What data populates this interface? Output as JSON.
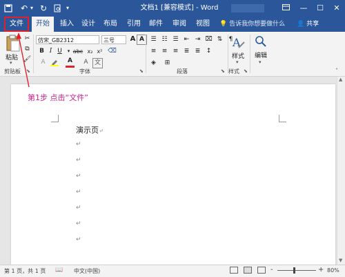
{
  "titlebar": {
    "title": "文档1 [兼容模式] - Word",
    "save_icon": "save-icon",
    "undo_icon": "undo-icon",
    "redo_icon": "redo-icon",
    "preview_icon": "print-preview-icon",
    "window_controls": [
      "ribbon-options-icon",
      "minimize-icon",
      "maximize-icon",
      "close-icon"
    ]
  },
  "tabs": [
    {
      "label": "文件",
      "id": "file"
    },
    {
      "label": "开始",
      "id": "home"
    },
    {
      "label": "插入",
      "id": "insert"
    },
    {
      "label": "设计",
      "id": "design"
    },
    {
      "label": "布局",
      "id": "layout"
    },
    {
      "label": "引用",
      "id": "references"
    },
    {
      "label": "邮件",
      "id": "mailings"
    },
    {
      "label": "审阅",
      "id": "review"
    },
    {
      "label": "视图",
      "id": "view"
    }
  ],
  "tell_me": "告诉我你想要做什么",
  "share": "共享",
  "ribbon": {
    "paste": "粘贴",
    "clipboard": "剪贴板",
    "font_name": "仿宋_GB2312",
    "font_size": "三号",
    "font_group": "字体",
    "paragraph_group": "段落",
    "styles_label": "样式",
    "styles_group": "样式",
    "edit_label": "编辑",
    "wen": "文",
    "a_big": "A"
  },
  "document": {
    "first_line": "演示页",
    "paragraph_mark": "↵"
  },
  "annotation": {
    "text": "第1步 点击“文件”",
    "color": "#c81f8d"
  },
  "status": {
    "page_info": "第 1 页，共 1 页",
    "language": "中文(中国)",
    "zoom": "80%",
    "minus": "-",
    "plus": "+"
  },
  "colors": {
    "brand": "#2b579a",
    "highlight_box": "#e0212b"
  }
}
